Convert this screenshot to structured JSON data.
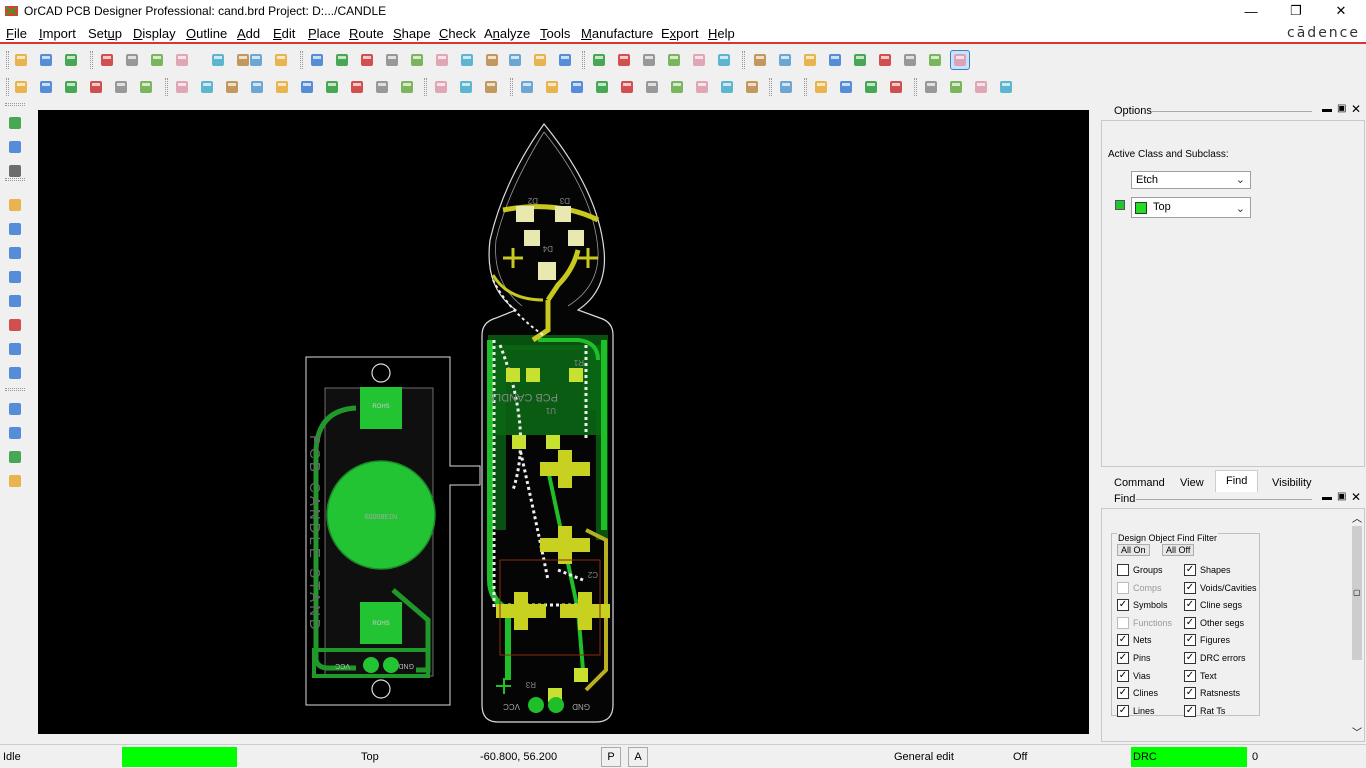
{
  "window": {
    "title": "OrCAD PCB Designer Professional: cand.brd  Project: D:.../CANDLE",
    "minimize": "—",
    "restore": "❐",
    "close": "✕"
  },
  "brand": "cādence",
  "menu": [
    {
      "label": "File",
      "u": "F",
      "rest": "ile"
    },
    {
      "label": "Import",
      "u": "I",
      "rest": "mport"
    },
    {
      "label": "Setup",
      "pre": "Set",
      "u": "u",
      "rest": "p"
    },
    {
      "label": "Display",
      "u": "D",
      "rest": "isplay"
    },
    {
      "label": "Outline",
      "u": "O",
      "rest": "utline"
    },
    {
      "label": "Add",
      "u": "A",
      "rest": "dd"
    },
    {
      "label": "Edit",
      "u": "E",
      "rest": "dit"
    },
    {
      "label": "Place",
      "u": "P",
      "rest": "lace"
    },
    {
      "label": "Route",
      "u": "R",
      "rest": "oute"
    },
    {
      "label": "Shape",
      "u": "S",
      "rest": "hape"
    },
    {
      "label": "Check",
      "u": "C",
      "rest": "heck"
    },
    {
      "label": "Analyze",
      "pre": "A",
      "u": "n",
      "rest": "alyze"
    },
    {
      "label": "Tools",
      "u": "T",
      "rest": "ools"
    },
    {
      "label": "Manufacture",
      "u": "M",
      "rest": "anufacture"
    },
    {
      "label": "Export",
      "pre": "E",
      "u": "x",
      "rest": "port"
    },
    {
      "label": "Help",
      "u": "H",
      "rest": "elp"
    }
  ],
  "board_text": {
    "stand": "PCB CANDLE STAND",
    "candle": "PCB CANDLE",
    "battery": "N1380059",
    "vcc": "VCC",
    "gnd": "GND",
    "r1": "R1",
    "r3": "R3",
    "c2": "C2",
    "d2": "D2",
    "d3": "D3",
    "d4": "D4",
    "u1": "U1",
    "stand_pad_top": "ROHS",
    "stand_pad_bot": "ROHS",
    "stand_vcc": "VCC",
    "stand_gnd": "GND"
  },
  "options": {
    "title": "Options",
    "active_label": "Active Class and Subclass:",
    "class_value": "Etch",
    "subclass_value": "Top",
    "subclass_color": "#22dd22"
  },
  "tabs": [
    "Command",
    "View",
    "Find",
    "Visibility"
  ],
  "active_tab": "Find",
  "find": {
    "title": "Find",
    "group_label": "Design Object Find Filter",
    "all_on": "All On",
    "all_off": "All Off",
    "left": [
      {
        "label": "Groups",
        "checked": false,
        "disabled": false
      },
      {
        "label": "Comps",
        "checked": false,
        "disabled": true
      },
      {
        "label": "Symbols",
        "checked": true,
        "disabled": false
      },
      {
        "label": "Functions",
        "checked": false,
        "disabled": true
      },
      {
        "label": "Nets",
        "checked": true,
        "disabled": false
      },
      {
        "label": "Pins",
        "checked": true,
        "disabled": false
      },
      {
        "label": "Vias",
        "checked": true,
        "disabled": false
      },
      {
        "label": "Clines",
        "checked": true,
        "disabled": false
      },
      {
        "label": "Lines",
        "checked": true,
        "disabled": false
      }
    ],
    "right": [
      {
        "label": "Shapes",
        "checked": true,
        "disabled": false
      },
      {
        "label": "Voids/Cavities",
        "checked": true,
        "disabled": false
      },
      {
        "label": "Cline segs",
        "checked": true,
        "disabled": false
      },
      {
        "label": "Other segs",
        "checked": true,
        "disabled": false
      },
      {
        "label": "Figures",
        "checked": true,
        "disabled": false
      },
      {
        "label": "DRC errors",
        "checked": true,
        "disabled": false
      },
      {
        "label": "Text",
        "checked": true,
        "disabled": false
      },
      {
        "label": "Ratsnests",
        "checked": true,
        "disabled": false
      },
      {
        "label": "Rat Ts",
        "checked": true,
        "disabled": false
      }
    ]
  },
  "status": {
    "state": "Idle",
    "layer": "Top",
    "coords": "-60.800, 56.200",
    "p_btn": "P",
    "a_btn": "A",
    "mode": "General edit",
    "off": "Off",
    "drc_label": "DRC",
    "drc_count": "0",
    "indicator_color": "#00ff00"
  }
}
